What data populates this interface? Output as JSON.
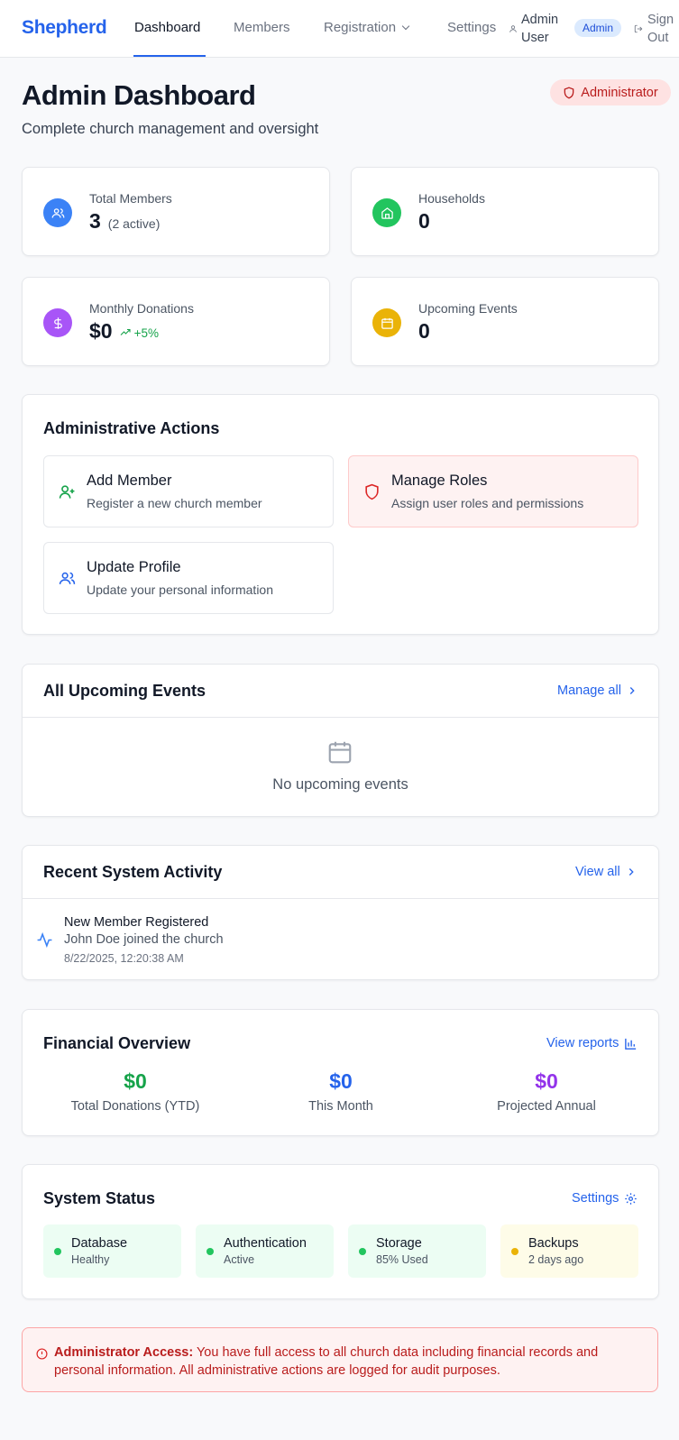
{
  "nav": {
    "brand": "Shepherd",
    "links": [
      "Dashboard",
      "Members",
      "Registration",
      "Settings"
    ],
    "user_name_line1": "Admin",
    "user_name_line2": "User",
    "user_badge": "Admin",
    "signout_line1": "Sign",
    "signout_line2": "Out"
  },
  "header": {
    "title": "Admin Dashboard",
    "subtitle": "Complete church management and oversight",
    "role": "Administrator"
  },
  "stats": [
    {
      "label": "Total Members",
      "value": "3",
      "extra": "(2 active)",
      "icon": "users-icon",
      "color": "#3b82f6"
    },
    {
      "label": "Households",
      "value": "0",
      "icon": "home-icon",
      "color": "#22c55e"
    },
    {
      "label": "Monthly Donations",
      "value": "$0",
      "trend": "+5%",
      "icon": "dollar-icon",
      "color": "#a855f7"
    },
    {
      "label": "Upcoming Events",
      "value": "0",
      "icon": "calendar-icon",
      "color": "#eab308"
    }
  ],
  "admin_actions": {
    "title": "Administrative Actions",
    "items": [
      {
        "title": "Add Member",
        "desc": "Register a new church member"
      },
      {
        "title": "Manage Roles",
        "desc": "Assign user roles and permissions"
      },
      {
        "title": "Update Profile",
        "desc": "Update your personal information"
      }
    ]
  },
  "events": {
    "title": "All Upcoming Events",
    "link": "Manage all",
    "empty": "No upcoming events"
  },
  "activity": {
    "title": "Recent System Activity",
    "link": "View all",
    "items": [
      {
        "title": "New Member Registered",
        "desc": "John Doe joined the church",
        "time": "8/22/2025, 12:20:38 AM"
      }
    ]
  },
  "financial": {
    "title": "Financial Overview",
    "link": "View reports",
    "items": [
      {
        "value": "$0",
        "label": "Total Donations (YTD)",
        "color": "#16a34a"
      },
      {
        "value": "$0",
        "label": "This Month",
        "color": "#2563eb"
      },
      {
        "value": "$0",
        "label": "Projected Annual",
        "color": "#9333ea"
      }
    ]
  },
  "system_status": {
    "title": "System Status",
    "link": "Settings",
    "items": [
      {
        "name": "Database",
        "detail": "Healthy",
        "state": "ok"
      },
      {
        "name": "Authentication",
        "detail": "Active",
        "state": "ok"
      },
      {
        "name": "Storage",
        "detail": "85% Used",
        "state": "ok"
      },
      {
        "name": "Backups",
        "detail": "2 days ago",
        "state": "warn"
      }
    ]
  },
  "alert": {
    "label": "Administrator Access:",
    "text": " You have full access to all church data including financial records and personal information. All administrative actions are logged for audit purposes."
  }
}
